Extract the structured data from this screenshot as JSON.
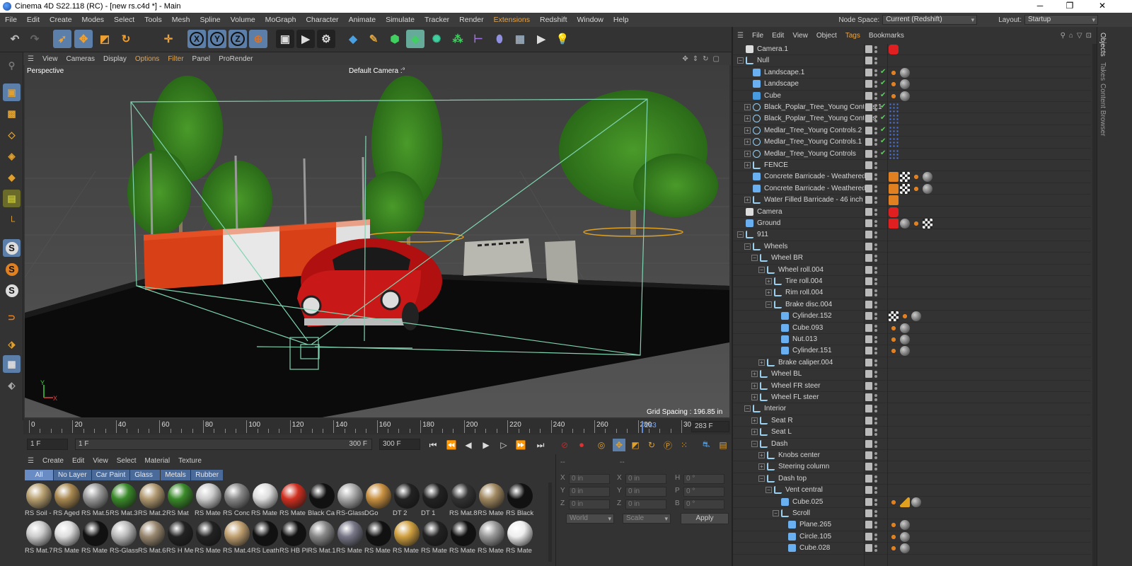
{
  "window": {
    "title": "Cinema 4D S22.118 (RC) - [new rs.c4d *] - Main",
    "controls": [
      "─",
      "❐",
      "✕"
    ]
  },
  "menu": {
    "items": [
      "File",
      "Edit",
      "Create",
      "Modes",
      "Select",
      "Tools",
      "Mesh",
      "Spline",
      "Volume",
      "MoGraph",
      "Character",
      "Animate",
      "Simulate",
      "Tracker",
      "Render",
      "Extensions",
      "Redshift",
      "Window",
      "Help"
    ],
    "node_space_label": "Node Space:",
    "node_space_value": "Current (Redshift)",
    "layout_label": "Layout:",
    "layout_value": "Startup"
  },
  "viewport": {
    "menu": [
      "View",
      "Cameras",
      "Display",
      "Options",
      "Filter",
      "Panel",
      "ProRender"
    ],
    "label": "Perspective",
    "camera": "Default Camera",
    "camera_suffix": ":°",
    "grid_spacing": "Grid Spacing : 196.85 in",
    "axis_y": "Y",
    "axis_x": "X"
  },
  "timeline": {
    "ticks": [
      "0",
      "20",
      "40",
      "60",
      "80",
      "100",
      "120",
      "140",
      "160",
      "180",
      "200",
      "220",
      "240",
      "260",
      "280",
      "300"
    ],
    "current_marker": "283",
    "current_frame": "283 F"
  },
  "transport": {
    "start": "1 F",
    "range_start": "1 F",
    "range_end": "300 F",
    "end": "300 F"
  },
  "materials": {
    "menu": [
      "Create",
      "Edit",
      "View",
      "Select",
      "Material",
      "Texture"
    ],
    "filters": [
      "All",
      "No Layer",
      "Car Paint",
      "Glass",
      "Metals",
      "Rubber"
    ],
    "row1": [
      "RS Soil -",
      "RS Aged",
      "RS Mat.5",
      "RS Mat.3",
      "RS Mat.2",
      "RS Mat",
      "RS Mate",
      "RS Conc",
      "RS Mate",
      "RS Mate",
      "Black Ca",
      "RS-Glass",
      "DGo",
      "DT 2",
      "DT 1",
      "RS Mat.8",
      "RS Mate",
      "RS Black"
    ],
    "row2": [
      "RS Mat.7",
      "RS Mate",
      "RS Mate",
      "RS-Glass",
      "RS Mat.6",
      "RS H Me",
      "RS Mate",
      "RS Mat.4",
      "RS Leath",
      "RS HB Pl",
      "RS Mat.1",
      "RS Mate",
      "RS Mate",
      "RS Mate",
      "RS Mate",
      "RS Mate",
      "RS Mate",
      "RS Mate"
    ]
  },
  "attributes": {
    "header": "--",
    "header2": "--",
    "rows": [
      {
        "a": "X",
        "av": "0 in",
        "b": "X",
        "bv": "0 in",
        "c": "H",
        "cv": "0 °"
      },
      {
        "a": "Y",
        "av": "0 in",
        "b": "Y",
        "bv": "0 in",
        "c": "P",
        "cv": "0 °"
      },
      {
        "a": "Z",
        "av": "0 in",
        "b": "Z",
        "bv": "0 in",
        "c": "B",
        "cv": "0 °"
      }
    ],
    "coord_mode": "World",
    "scale_mode": "Scale",
    "apply": "Apply"
  },
  "objects": {
    "menu": [
      "File",
      "Edit",
      "View",
      "Object",
      "Tags",
      "Bookmarks"
    ],
    "items": [
      {
        "name": "Camera.1",
        "indent": 0,
        "icon": "camera",
        "exp": ""
      },
      {
        "name": "Null",
        "indent": 0,
        "icon": "null",
        "exp": "-"
      },
      {
        "name": "Landscape.1",
        "indent": 1,
        "icon": "landscape",
        "exp": ""
      },
      {
        "name": "Landscape",
        "indent": 1,
        "icon": "landscape",
        "exp": ""
      },
      {
        "name": "Cube",
        "indent": 1,
        "icon": "cube",
        "exp": ""
      },
      {
        "name": "Black_Poplar_Tree_Young Controls.1",
        "indent": 1,
        "icon": "ctrl",
        "exp": "+"
      },
      {
        "name": "Black_Poplar_Tree_Young Controls",
        "indent": 1,
        "icon": "ctrl",
        "exp": "+"
      },
      {
        "name": "Medlar_Tree_Young Controls.2",
        "indent": 1,
        "icon": "ctrl",
        "exp": "+"
      },
      {
        "name": "Medlar_Tree_Young Controls.1",
        "indent": 1,
        "icon": "ctrl",
        "exp": "+"
      },
      {
        "name": "Medlar_Tree_Young Controls",
        "indent": 1,
        "icon": "ctrl",
        "exp": "+"
      },
      {
        "name": "FENCE",
        "indent": 1,
        "icon": "null",
        "exp": "+"
      },
      {
        "name": "Concrete Barricade - Weathered.1",
        "indent": 1,
        "icon": "poly",
        "exp": ""
      },
      {
        "name": "Concrete Barricade - Weathered",
        "indent": 1,
        "icon": "poly",
        "exp": ""
      },
      {
        "name": "Water Filled Barricade - 46 inch",
        "indent": 1,
        "icon": "null",
        "exp": "+"
      },
      {
        "name": "Camera",
        "indent": 0,
        "icon": "camera",
        "exp": ""
      },
      {
        "name": "Ground",
        "indent": 0,
        "icon": "poly",
        "exp": ""
      },
      {
        "name": "911",
        "indent": 0,
        "icon": "null",
        "exp": "-"
      },
      {
        "name": "Wheels",
        "indent": 1,
        "icon": "null",
        "exp": "-"
      },
      {
        "name": "Wheel BR",
        "indent": 2,
        "icon": "null",
        "exp": "-"
      },
      {
        "name": "Wheel roll.004",
        "indent": 3,
        "icon": "null",
        "exp": "-"
      },
      {
        "name": "Tire roll.004",
        "indent": 4,
        "icon": "null",
        "exp": "+"
      },
      {
        "name": "Rim roll.004",
        "indent": 4,
        "icon": "null",
        "exp": "+"
      },
      {
        "name": "Brake disc.004",
        "indent": 4,
        "icon": "null",
        "exp": "-"
      },
      {
        "name": "Cylinder.152",
        "indent": 5,
        "icon": "poly",
        "exp": ""
      },
      {
        "name": "Cube.093",
        "indent": 5,
        "icon": "poly",
        "exp": ""
      },
      {
        "name": "Nut.013",
        "indent": 5,
        "icon": "poly",
        "exp": ""
      },
      {
        "name": "Cylinder.151",
        "indent": 5,
        "icon": "poly",
        "exp": ""
      },
      {
        "name": "Brake caliper.004",
        "indent": 3,
        "icon": "null",
        "exp": "+"
      },
      {
        "name": "Wheel BL",
        "indent": 2,
        "icon": "null",
        "exp": "+"
      },
      {
        "name": "Wheel FR steer",
        "indent": 2,
        "icon": "null",
        "exp": "+"
      },
      {
        "name": "Wheel FL steer",
        "indent": 2,
        "icon": "null",
        "exp": "+"
      },
      {
        "name": "Interior",
        "indent": 1,
        "icon": "null",
        "exp": "-"
      },
      {
        "name": "Seat R",
        "indent": 2,
        "icon": "null",
        "exp": "+"
      },
      {
        "name": "Seat L",
        "indent": 2,
        "icon": "null",
        "exp": "+"
      },
      {
        "name": "Dash",
        "indent": 2,
        "icon": "null",
        "exp": "-"
      },
      {
        "name": "Knobs center",
        "indent": 3,
        "icon": "null",
        "exp": "+"
      },
      {
        "name": "Steering column",
        "indent": 3,
        "icon": "null",
        "exp": "+"
      },
      {
        "name": "Dash top",
        "indent": 3,
        "icon": "null",
        "exp": "-"
      },
      {
        "name": "Vent central",
        "indent": 4,
        "icon": "null",
        "exp": "-"
      },
      {
        "name": "Cube.025",
        "indent": 5,
        "icon": "poly",
        "exp": ""
      },
      {
        "name": "Scroll",
        "indent": 5,
        "icon": "null",
        "exp": "-"
      },
      {
        "name": "Plane.265",
        "indent": 6,
        "icon": "poly",
        "exp": ""
      },
      {
        "name": "Circle.105",
        "indent": 6,
        "icon": "poly",
        "exp": ""
      },
      {
        "name": "Cube.028",
        "indent": 6,
        "icon": "poly",
        "exp": ""
      }
    ]
  },
  "sidetabs": [
    "Objects",
    "Takes",
    "Content Browser"
  ],
  "colors": {
    "accent": "#e8a447",
    "select": "#5b7fa8",
    "car": "#c01010"
  }
}
